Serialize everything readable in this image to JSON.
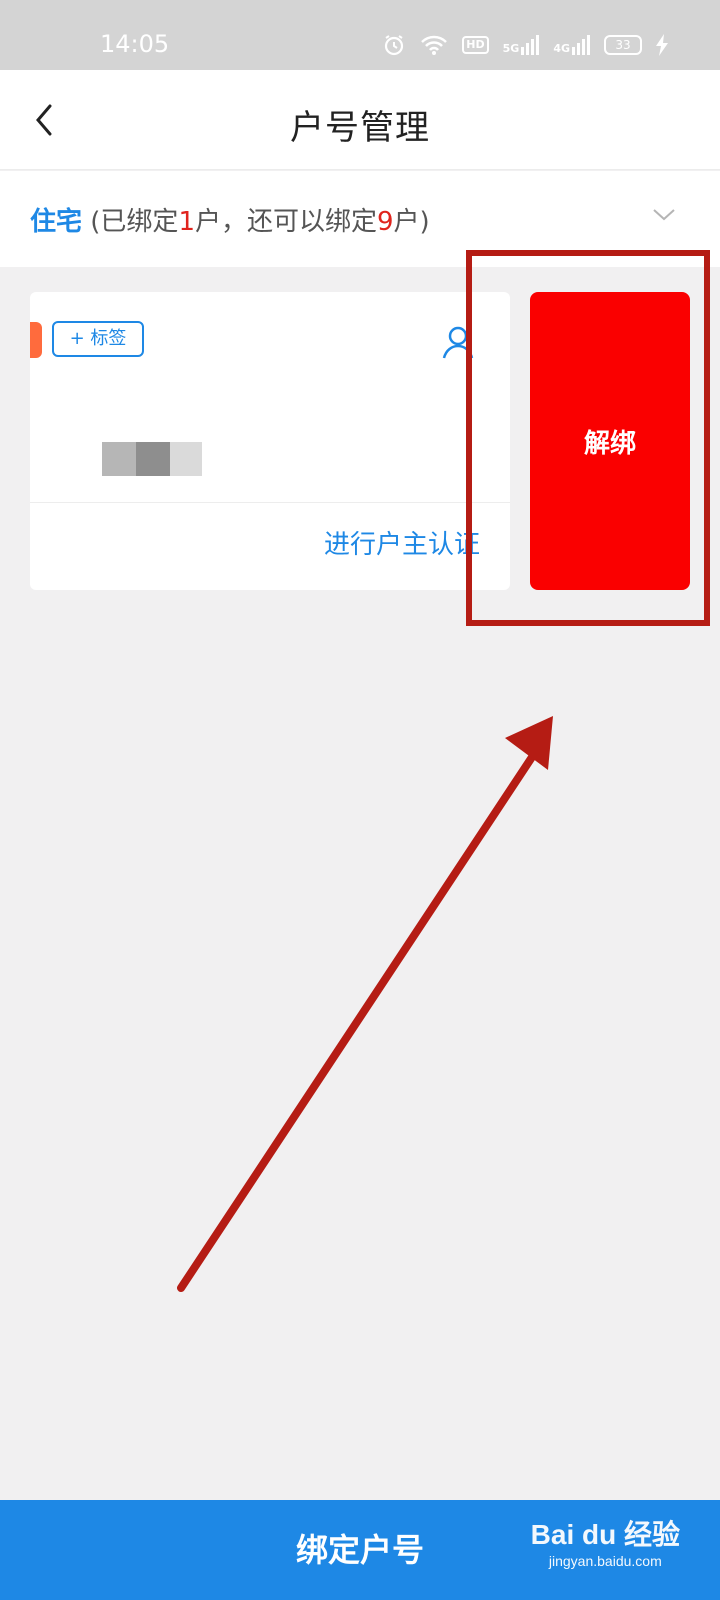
{
  "status_bar": {
    "time": "14:05",
    "network_5g": "5G",
    "network_4g": "4G",
    "hd_badge": "HD",
    "battery": "33",
    "icons": [
      "alarm-icon",
      "wifi-icon",
      "hd-icon",
      "signal-icon",
      "signal-icon",
      "battery-icon",
      "charging-icon"
    ]
  },
  "header": {
    "title": "户号管理",
    "back_icon": "chevron-left-icon"
  },
  "category": {
    "name": "住宅",
    "open_paren": " (已绑定",
    "bound_count": "1",
    "middle": "户，还可以绑定",
    "available_count": "9",
    "close_paren": "户)",
    "expand_icon": "chevron-down-icon"
  },
  "account_card": {
    "tag_button_label": "+ 标签",
    "user_icon": "user-icon",
    "verify_link": "进行户主认证"
  },
  "unbind_button": {
    "label": "解绑"
  },
  "bottom_bar": {
    "bind_button_label": "绑定户号",
    "watermark_logo": "Bai du 经验",
    "watermark_sub": "jingyan.baidu.com"
  },
  "colors": {
    "primary_blue": "#1e88e5",
    "unbind_red": "#fa0000",
    "annotation_red": "#b51c14",
    "tag_orange": "#ff6b3d",
    "count_red": "#e0241d"
  }
}
